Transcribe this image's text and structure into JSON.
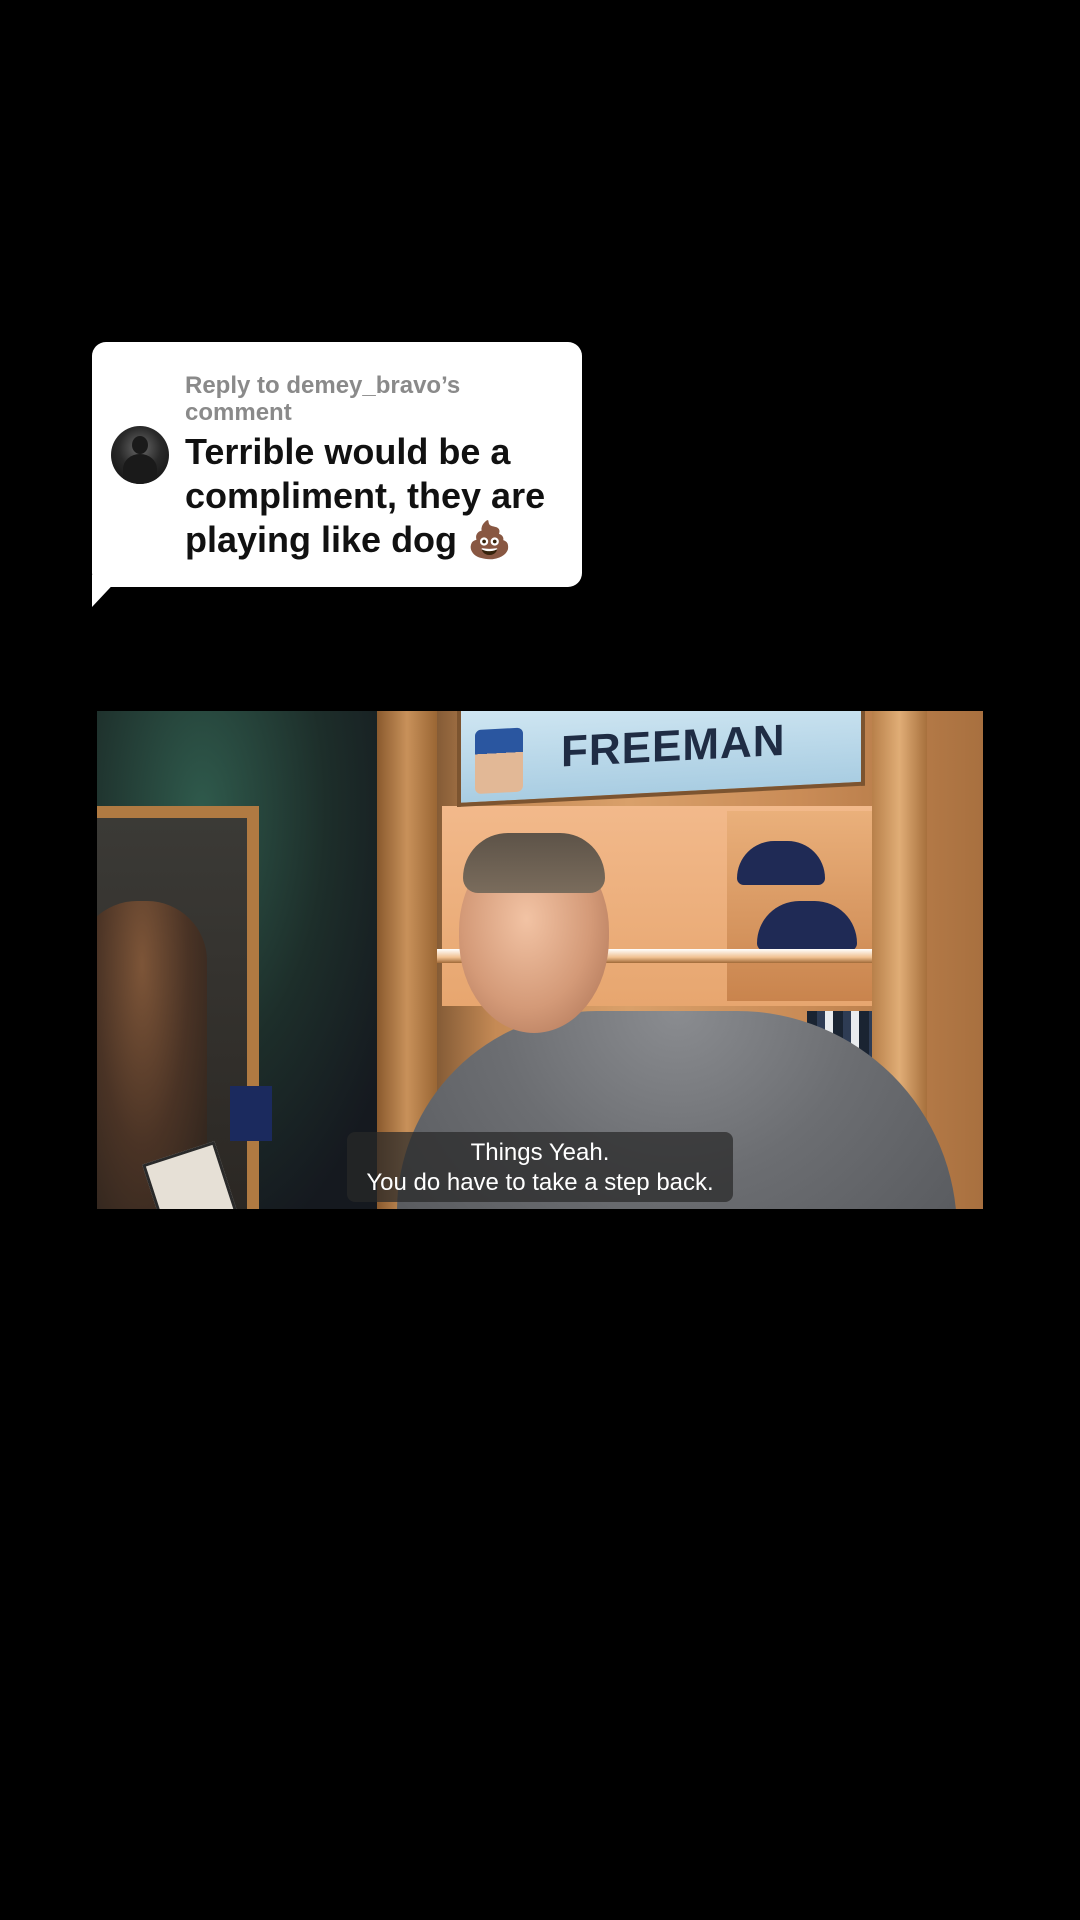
{
  "reply": {
    "header": "Reply to demey_bravo’s comment",
    "comment": "Terrible would be a compliment, they are playing like dog 💩",
    "avatar_icon": "user-avatar-icon"
  },
  "video": {
    "nameplate_text": "FREEMAN",
    "captions": {
      "line1": "Things Yeah.",
      "line2": "You do have to take a step back."
    }
  }
}
